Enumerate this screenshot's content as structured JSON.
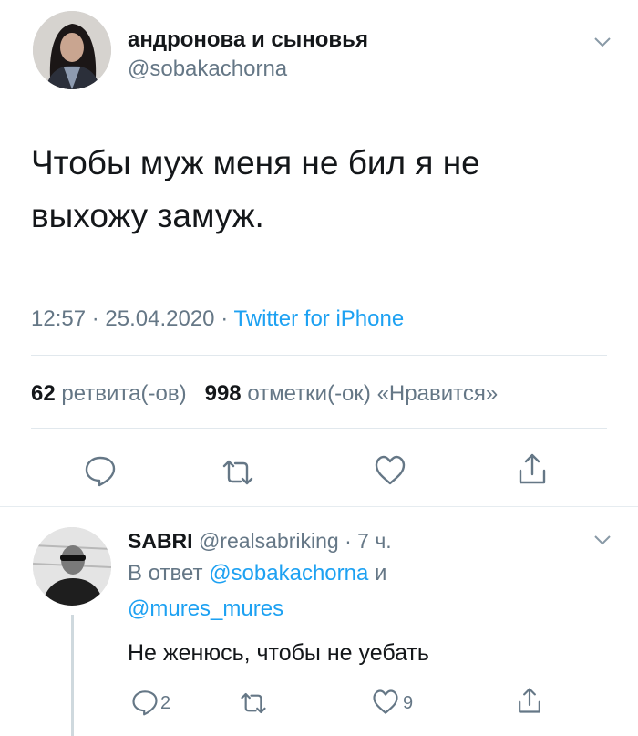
{
  "tweet": {
    "author_name": "андронова и сыновья",
    "author_handle": "@sobakachorna",
    "text_line1": "Чтобы муж меня не бил я не",
    "text_line2": "выхожу замуж.",
    "time": "12:57",
    "date": "25.04.2020",
    "source": "Twitter for iPhone",
    "meta_sep": "·",
    "retweets_count": "62",
    "retweets_label": "ретвита(-ов)",
    "likes_count": "998",
    "likes_label": "отметки(-ок) «Нравится»"
  },
  "reply": {
    "author_name": "SABRI",
    "author_handle": "@realsabriking",
    "time_ago": "· 7 ч.",
    "reply_to_prefix": "В ответ",
    "reply_to_user1": "@sobakachorna",
    "reply_to_and": "и",
    "reply_to_user2": "@mures_mures",
    "text": "Не женюсь, чтобы не уебать",
    "reply_count": "2",
    "like_count": "9"
  },
  "icons": {
    "reply": "speech-bubble-icon",
    "retweet": "retweet-icon",
    "like": "heart-icon",
    "share": "share-icon",
    "menu": "chevron-down-icon"
  },
  "colors": {
    "text": "#14171a",
    "secondary": "#657786",
    "link": "#1da1f2",
    "divider": "#e1e8ed"
  }
}
